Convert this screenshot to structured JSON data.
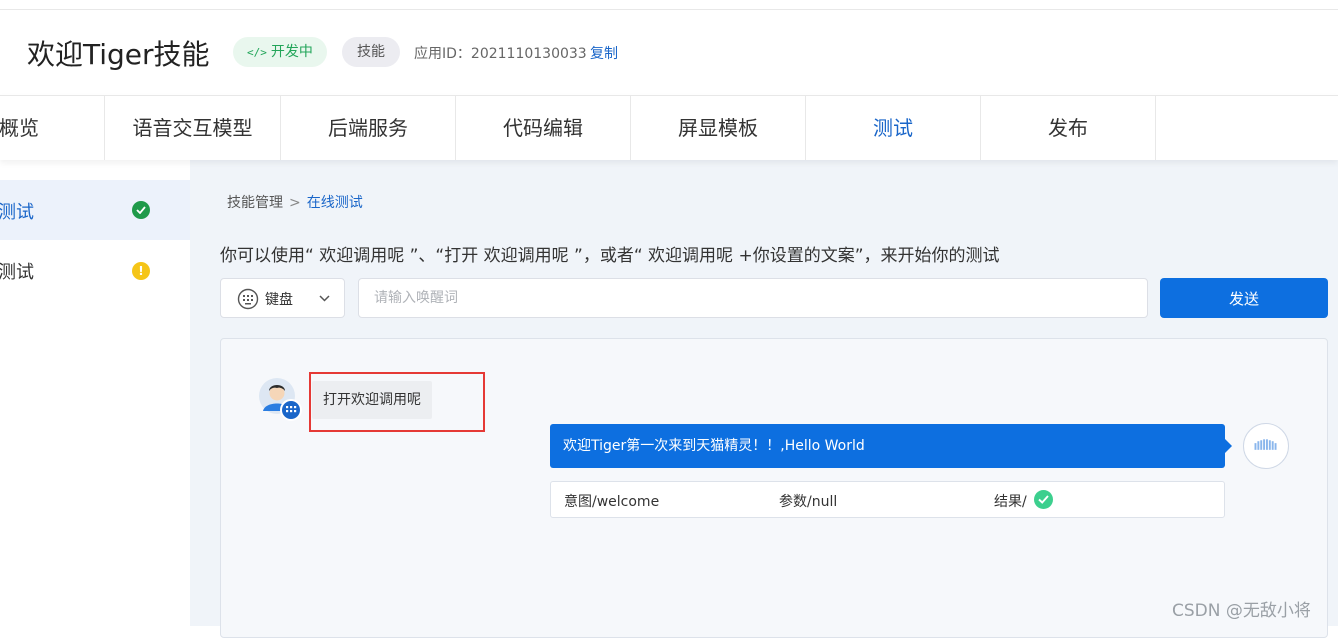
{
  "header": {
    "title": "欢迎Tiger技能",
    "status_badge": "开发中",
    "status_icon": "code-icon",
    "type_badge": "技能",
    "app_id_label": "应用ID：2021110130033",
    "copy_label": "复制"
  },
  "tabs": [
    {
      "label": "概览",
      "active": false
    },
    {
      "label": "语音交互模型",
      "active": false
    },
    {
      "label": "后端服务",
      "active": false
    },
    {
      "label": "代码编辑",
      "active": false
    },
    {
      "label": "屏显模板",
      "active": false
    },
    {
      "label": "测试",
      "active": true
    },
    {
      "label": "发布",
      "active": false
    }
  ],
  "sidebar": {
    "items": [
      {
        "label": "测试",
        "status": "ok",
        "active": true
      },
      {
        "label": "测试",
        "status": "warning",
        "active": false
      }
    ],
    "warning_glyph": "!"
  },
  "breadcrumb": {
    "parent": "技能管理",
    "separator": ">",
    "current": "在线测试"
  },
  "instruction": "你可以使用“ 欢迎调用呢 ”、“打开 欢迎调用呢 ”，或者“ 欢迎调用呢 +你设置的文案”，来开始你的测试",
  "input_bar": {
    "mode_label": "键盘",
    "mode_icon": "keyboard-icon",
    "placeholder": "请输入唤醒词",
    "value": "",
    "send_label": "发送"
  },
  "chat": {
    "user_message": "打开欢迎调用呢",
    "bot_message": "欢迎Tiger第一次来到天猫精灵！！,Hello World",
    "result": {
      "intent": "意图/welcome",
      "params": "参数/null",
      "result": "结果/",
      "result_status": "success"
    }
  },
  "watermark": "CSDN @无敌小将",
  "colors": {
    "accent": "#0d6fe0",
    "link": "#1a66c9",
    "success": "#1f9a4a",
    "warning": "#f5c518",
    "highlight": "#e53935"
  }
}
